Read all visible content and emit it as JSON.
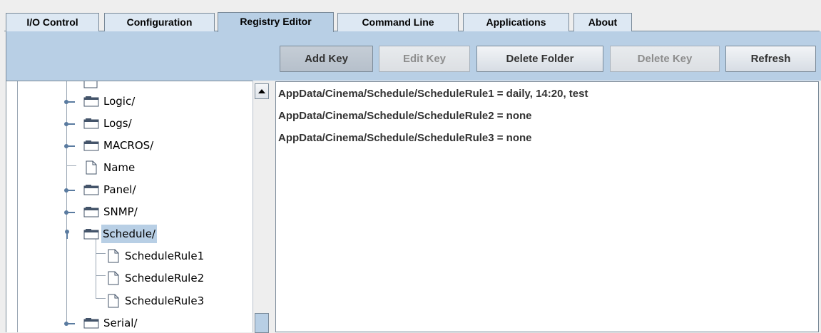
{
  "tabs": [
    {
      "label": "I/O Control",
      "active": false
    },
    {
      "label": "Configuration",
      "active": false
    },
    {
      "label": "Registry Editor",
      "active": true
    },
    {
      "label": "Command Line",
      "active": false
    },
    {
      "label": "Applications",
      "active": false
    },
    {
      "label": "About",
      "active": false
    }
  ],
  "toolbar": {
    "add_key": "Add Key",
    "edit_key": "Edit Key",
    "delete_folder": "Delete Folder",
    "delete_key": "Delete Key",
    "refresh": "Refresh"
  },
  "tree": {
    "items": [
      {
        "label": "Logic/",
        "type": "folder",
        "expanded": false
      },
      {
        "label": "Logs/",
        "type": "folder",
        "expanded": false
      },
      {
        "label": "MACROS/",
        "type": "folder",
        "expanded": false
      },
      {
        "label": "Name",
        "type": "file"
      },
      {
        "label": "Panel/",
        "type": "folder",
        "expanded": false
      },
      {
        "label": "SNMP/",
        "type": "folder",
        "expanded": false
      },
      {
        "label": "Schedule/",
        "type": "folder",
        "expanded": true,
        "selected": true
      },
      {
        "label": "ScheduleRule1",
        "type": "file",
        "child": true
      },
      {
        "label": "ScheduleRule2",
        "type": "file",
        "child": true
      },
      {
        "label": "ScheduleRule3",
        "type": "file",
        "child": true
      },
      {
        "label": "Serial/",
        "type": "folder",
        "expanded": false
      }
    ]
  },
  "values": [
    "AppData/Cinema/Schedule/ScheduleRule1 = daily, 14:20, test",
    "AppData/Cinema/Schedule/ScheduleRule2 = none",
    "AppData/Cinema/Schedule/ScheduleRule3 = none"
  ],
  "colors": {
    "active_tab": "#b8cfe5",
    "inactive_tab": "#dde8f3",
    "selection": "#b8cfe5",
    "border": "#7a8a99"
  }
}
